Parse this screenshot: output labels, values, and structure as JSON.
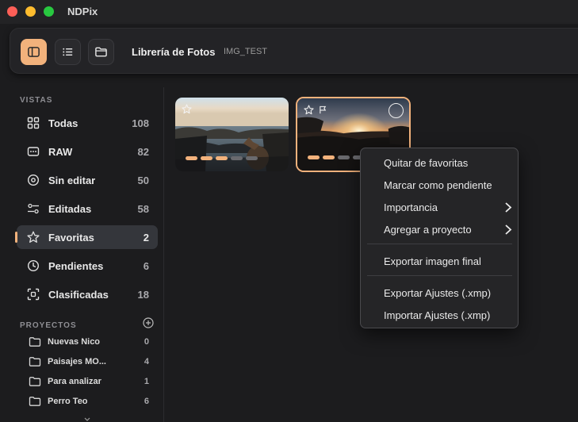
{
  "window": {
    "title": "NDPix"
  },
  "toolbar": {
    "title": "Librería de Fotos",
    "subtitle": "IMG_TEST",
    "buttons": [
      {
        "icon": "sidebar-icon",
        "active": true
      },
      {
        "icon": "list-icon",
        "active": false
      },
      {
        "icon": "folder-icon",
        "active": false
      }
    ]
  },
  "sidebar": {
    "views_label": "VISTAS",
    "views": [
      {
        "label": "Todas",
        "count": "108",
        "icon": "grid-icon"
      },
      {
        "label": "RAW",
        "count": "82",
        "icon": "raw-icon"
      },
      {
        "label": "Sin editar",
        "count": "50",
        "icon": "circle-icon"
      },
      {
        "label": "Editadas",
        "count": "58",
        "icon": "sliders-icon"
      },
      {
        "label": "Favoritas",
        "count": "2",
        "icon": "star-icon",
        "selected": true
      },
      {
        "label": "Pendientes",
        "count": "6",
        "icon": "clock-icon"
      },
      {
        "label": "Clasificadas",
        "count": "18",
        "icon": "focus-icon"
      }
    ],
    "projects_label": "PROYECTOS",
    "projects": [
      {
        "label": "Nuevas Nico",
        "count": "0"
      },
      {
        "label": "Paisajes MO...",
        "count": "4"
      },
      {
        "label": "Para analizar",
        "count": "1"
      },
      {
        "label": "Perro Teo",
        "count": "6"
      }
    ]
  },
  "photos": [
    {
      "favorite": true,
      "rating": 3,
      "selected": false
    },
    {
      "favorite": true,
      "rating": 2,
      "selected": true
    }
  ],
  "context_menu": {
    "items": [
      {
        "label": "Quitar de favoritas"
      },
      {
        "label": "Marcar como pendiente"
      },
      {
        "label": "Importancia",
        "submenu": true
      },
      {
        "label": "Agregar a proyecto",
        "submenu": true
      },
      {
        "label": "Exportar imagen final"
      },
      {
        "label": "Exportar Ajustes (.xmp)"
      },
      {
        "label": "Importar Ajustes (.xmp)"
      }
    ]
  },
  "colors": {
    "accent": "#f2b27c",
    "background": "#1c1c1e",
    "selected_row": "#34363b"
  }
}
